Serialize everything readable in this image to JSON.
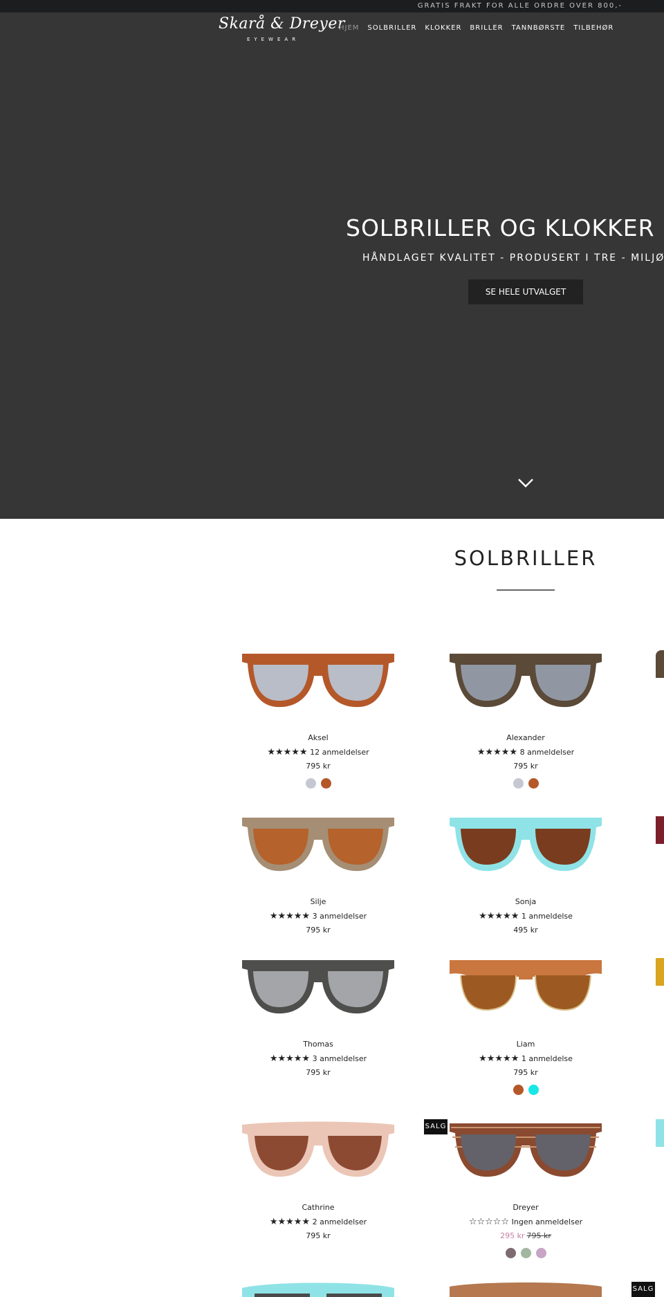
{
  "announcement": "GRATIS FRAKT FOR ALLE ORDRE OVER 800,-",
  "brand": {
    "script": "Skarå & Dreyer",
    "sub": "EYEWEAR"
  },
  "nav": [
    {
      "label": "HJEM",
      "active": true
    },
    {
      "label": "SOLBRILLER"
    },
    {
      "label": "KLOKKER"
    },
    {
      "label": "BRILLER"
    },
    {
      "label": "TANNBØRSTE"
    },
    {
      "label": "TILBEHØR"
    }
  ],
  "hero": {
    "title": "SOLBRILLER OG KLOKKER I TRE",
    "subtitle": "HÅNDLAGET KVALITET - PRODUSERT I TRE - MILJØVENNLIG",
    "button": "SE HELE UTVALGET",
    "scroll_icon": "chevron-down-icon"
  },
  "section": {
    "title": "SOLBRILLER"
  },
  "colors": {
    "frame_orange": "#b4582a",
    "frame_brown": "#5b4a38",
    "lens_gray": "#9097a3",
    "lens_brown": "#7a3c1f",
    "cyan_frame": "#8fe3e6"
  },
  "products": [
    {
      "name": "Aksel",
      "stars": "★★★★★",
      "reviews": "12 anmeldelser",
      "price": "795 kr",
      "swatches": [
        "#c5c8d1",
        "#b4582a"
      ]
    },
    {
      "name": "Alexander",
      "stars": "★★★★★",
      "reviews": "8 anmeldelser",
      "price": "795 kr",
      "swatches": [
        "#c5c8d1",
        "#b4582a"
      ]
    },
    {
      "name": "Silje",
      "stars": "★★★★★",
      "reviews": "3 anmeldelser",
      "price": "795 kr",
      "swatches": []
    },
    {
      "name": "Sonja",
      "stars": "★★★★★",
      "reviews": "1 anmeldelse",
      "price": "495 kr",
      "swatches": []
    },
    {
      "name": "Thomas",
      "stars": "★★★★★",
      "reviews": "3 anmeldelser",
      "price": "795 kr",
      "swatches": []
    },
    {
      "name": "Liam",
      "stars": "★★★★★",
      "reviews": "1 anmeldelse",
      "price": "795 kr",
      "swatches": [
        "#b4582a",
        "#19e6e6"
      ]
    },
    {
      "name": "Cathrine",
      "stars": "★★★★★",
      "reviews": "2 anmeldelser",
      "price": "795 kr",
      "swatches": []
    },
    {
      "name": "Dreyer",
      "stars": "☆☆☆☆☆",
      "reviews": "Ingen anmeldelser",
      "price": "295 kr",
      "old_price": "795 kr",
      "badge": "SALG",
      "swatches": [
        "#7d6b70",
        "#a3b6a0",
        "#c8a4c6"
      ]
    }
  ],
  "bottom_badge": "SALG"
}
